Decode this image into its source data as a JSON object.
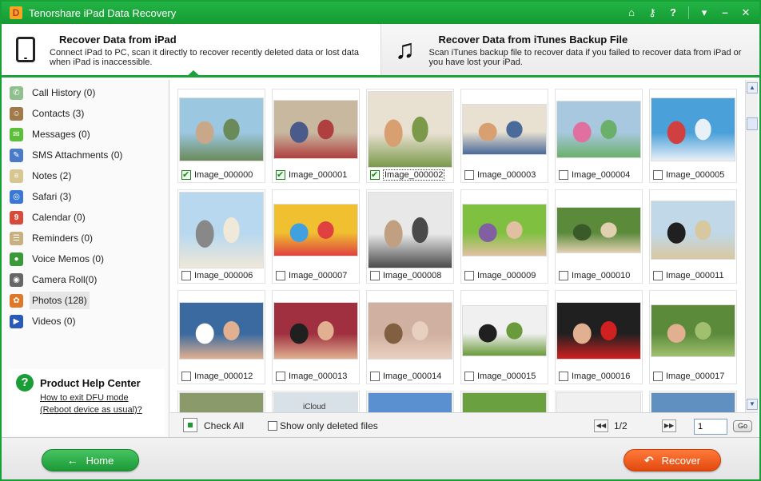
{
  "app": {
    "title": "Tenorshare iPad Data Recovery",
    "logo_letter": "D",
    "controls": [
      "home-icon",
      "key-icon",
      "help-icon",
      "menu-icon",
      "minimize-icon",
      "close-icon"
    ]
  },
  "modes": [
    {
      "title": "Recover Data from iPad",
      "description": "Connect iPad to PC, scan it directly to recover recently deleted data or lost data when iPad is inaccessible.",
      "icon": "ipad-icon",
      "active": true
    },
    {
      "title": "Recover Data from iTunes Backup File",
      "description": "Scan iTunes backup file to recover data if you failed to recover data from iPad or you have lost your iPad.",
      "icon": "music-note-icon",
      "active": false
    }
  ],
  "sidebar": {
    "items": [
      {
        "label": "Call History (0)",
        "icon": "phone-icon",
        "color": "#8fbf8f"
      },
      {
        "label": "Contacts (3)",
        "icon": "contacts-icon",
        "color": "#a07a4a"
      },
      {
        "label": "Messages (0)",
        "icon": "messages-icon",
        "color": "#5cbf3a"
      },
      {
        "label": "SMS Attachments (0)",
        "icon": "attachment-icon",
        "color": "#4a7ac8"
      },
      {
        "label": "Notes (2)",
        "icon": "notes-icon",
        "color": "#d8c690"
      },
      {
        "label": "Safari (3)",
        "icon": "safari-icon",
        "color": "#3a78d8"
      },
      {
        "label": "Calendar (0)",
        "icon": "calendar-icon",
        "color": "#d84a3a"
      },
      {
        "label": "Reminders (0)",
        "icon": "reminders-icon",
        "color": "#c8b080"
      },
      {
        "label": "Voice Memos (0)",
        "icon": "microphone-icon",
        "color": "#3a9a3a"
      },
      {
        "label": "Camera Roll(0)",
        "icon": "camera-icon",
        "color": "#666666"
      },
      {
        "label": "Photos (128)",
        "icon": "photos-icon",
        "color": "#e0782a",
        "selected": true
      },
      {
        "label": "Videos (0)",
        "icon": "videos-icon",
        "color": "#2a5ab8"
      }
    ],
    "help": {
      "title": "Product Help Center",
      "link1": "How to exit DFU mode",
      "link2": "(Reboot device as usual)?"
    }
  },
  "gallery": {
    "images": [
      {
        "name": "Image_000000",
        "checked": true,
        "colors": [
          "#9cc7e0",
          "#6a8a5a",
          "#c9a88a"
        ]
      },
      {
        "name": "Image_000001",
        "checked": true,
        "colors": [
          "#c8b8a0",
          "#b04040",
          "#4a5a8a"
        ]
      },
      {
        "name": "Image_000002",
        "checked": true,
        "colors": [
          "#e8e0d0",
          "#7a9a4a",
          "#d8a070"
        ],
        "focused": true
      },
      {
        "name": "Image_000003",
        "checked": false,
        "colors": [
          "#e8e0d0",
          "#4a6a9a",
          "#d8a070"
        ]
      },
      {
        "name": "Image_000004",
        "checked": false,
        "colors": [
          "#a8c8e0",
          "#6ab06a",
          "#e070a0"
        ]
      },
      {
        "name": "Image_000005",
        "checked": false,
        "colors": [
          "#4aa0d8",
          "#e8f0f8",
          "#d04040"
        ]
      },
      {
        "name": "Image_000006",
        "checked": false,
        "colors": [
          "#b8d8f0",
          "#f0e8d8",
          "#888888"
        ]
      },
      {
        "name": "Image_000007",
        "checked": false,
        "colors": [
          "#f0c030",
          "#e04040",
          "#40a0e0"
        ]
      },
      {
        "name": "Image_000008",
        "checked": false,
        "colors": [
          "#e8e8e8",
          "#4a4a4a",
          "#c0a080"
        ]
      },
      {
        "name": "Image_000009",
        "checked": false,
        "colors": [
          "#80c040",
          "#e0c0a0",
          "#8060a0"
        ]
      },
      {
        "name": "Image_000010",
        "checked": false,
        "colors": [
          "#5a8a3a",
          "#e0d0b0",
          "#3a5a2a"
        ]
      },
      {
        "name": "Image_000011",
        "checked": false,
        "colors": [
          "#c0d8e8",
          "#d8c8a0",
          "#202020"
        ]
      },
      {
        "name": "Image_000012",
        "checked": false,
        "colors": [
          "#3a6aa0",
          "#e0b090",
          "#ffffff"
        ]
      },
      {
        "name": "Image_000013",
        "checked": false,
        "colors": [
          "#a03040",
          "#e0b090",
          "#202020"
        ]
      },
      {
        "name": "Image_000014",
        "checked": false,
        "colors": [
          "#d0b0a0",
          "#e8d0c0",
          "#806040"
        ]
      },
      {
        "name": "Image_000015",
        "checked": false,
        "colors": [
          "#f0f0f0",
          "#6a9a3a",
          "#202020"
        ]
      },
      {
        "name": "Image_000016",
        "checked": false,
        "colors": [
          "#202020",
          "#d02020",
          "#e0b090"
        ]
      },
      {
        "name": "Image_000017",
        "checked": false,
        "colors": [
          "#5a8a3a",
          "#a0c070",
          "#e0b090"
        ]
      },
      {
        "name": "",
        "checked": false,
        "colors": [
          "#8a9a6a",
          "#3a3a3a",
          "#c0a080"
        ]
      },
      {
        "name": "",
        "checked": false,
        "colors": [
          "#d8e0e8",
          "#a0b0c0",
          "#f8f8f8"
        ],
        "caption": "iCloud"
      },
      {
        "name": "",
        "checked": false,
        "colors": [
          "#5a90d0",
          "#f0f0f0",
          "#d04040"
        ]
      },
      {
        "name": "",
        "checked": false,
        "colors": [
          "#6aa040",
          "#e0e0e0",
          "#d04040"
        ]
      },
      {
        "name": "",
        "checked": false,
        "colors": [
          "#f0f0f0",
          "#d04040",
          "#808080"
        ]
      },
      {
        "name": "",
        "checked": false,
        "colors": [
          "#6090c0",
          "#d0a060",
          "#e0e0e0"
        ]
      }
    ]
  },
  "bottom_bar": {
    "check_all": "Check All",
    "show_deleted": "Show only deleted files",
    "page": "1/2",
    "page_input": "1",
    "go": "Go"
  },
  "footer": {
    "home": "Home",
    "recover": "Recover"
  }
}
